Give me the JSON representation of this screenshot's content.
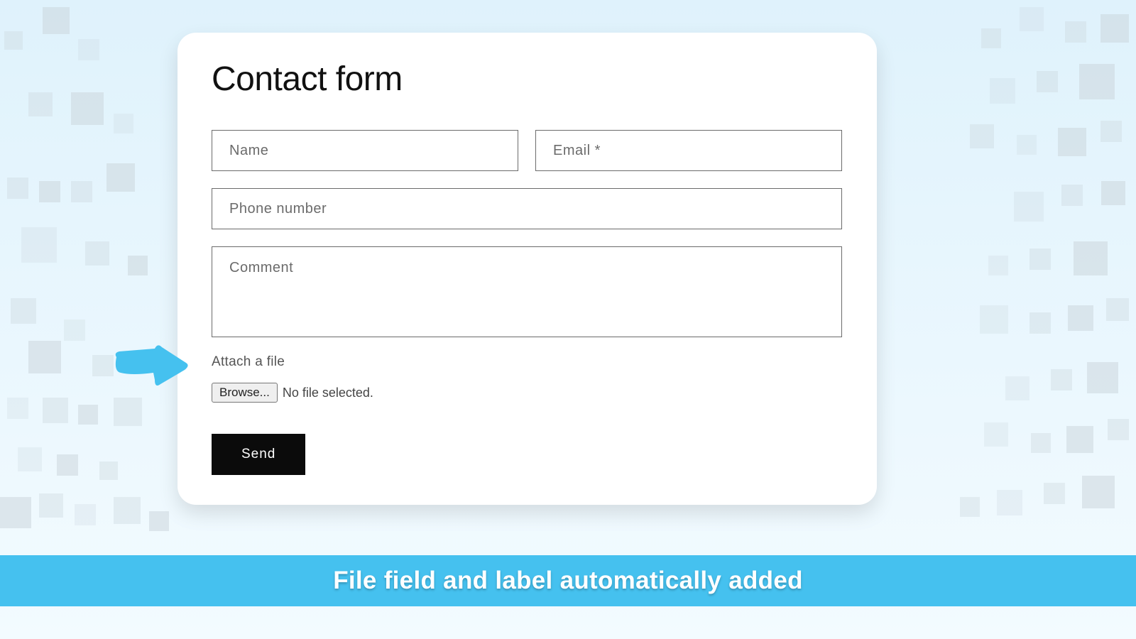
{
  "form": {
    "title": "Contact form",
    "name_placeholder": "Name",
    "email_placeholder": "Email *",
    "phone_placeholder": "Phone number",
    "comment_placeholder": "Comment",
    "attach_label": "Attach a file",
    "browse_label": "Browse...",
    "file_status": "No file selected.",
    "send_label": "Send"
  },
  "banner": {
    "text": "File field and label automatically added"
  },
  "colors": {
    "accent": "#45c1ef",
    "button_bg": "#0b0b0b"
  }
}
